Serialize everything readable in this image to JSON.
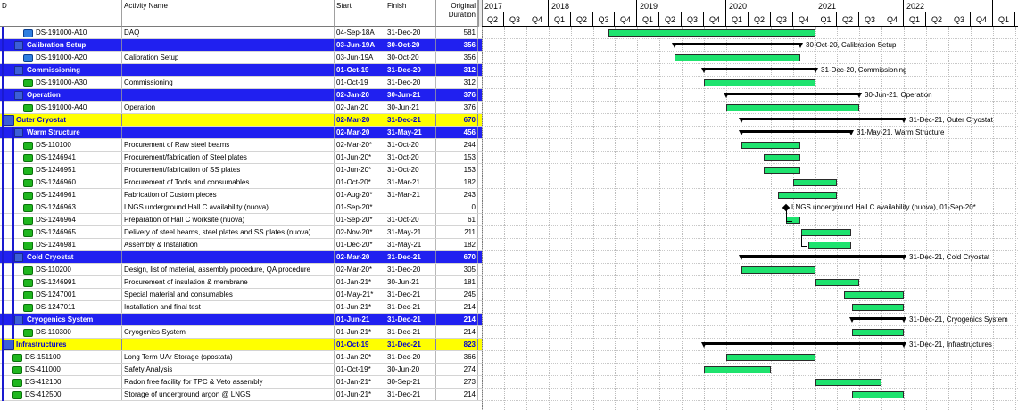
{
  "columns": {
    "id": "D",
    "name": "Activity Name",
    "start": "Start",
    "finish": "Finish",
    "duration_line1": "Original",
    "duration_line2": "Duration"
  },
  "timeline": {
    "years": [
      "2017",
      "2018",
      "2019",
      "2020",
      "2021",
      "2022"
    ],
    "quarters": [
      "Q2",
      "Q3",
      "Q4",
      "Q1",
      "Q2",
      "Q3",
      "Q4",
      "Q1",
      "Q2",
      "Q3",
      "Q4",
      "Q1",
      "Q2",
      "Q3",
      "Q4",
      "Q1",
      "Q2",
      "Q3",
      "Q4",
      "Q1",
      "Q2",
      "Q3",
      "Q4",
      "Q1"
    ]
  },
  "rows": [
    {
      "type": "act",
      "icon": "mile",
      "level": 2,
      "id": "DS-191000-A10",
      "name": "DAQ",
      "start": "04-Sep-18A",
      "finish": "31-Dec-20",
      "dur": "581",
      "bar": {
        "s": 2018.676,
        "f": 2021.0
      },
      "label": ""
    },
    {
      "type": "wbs1",
      "level": 1,
      "id": "Calibration Setup",
      "name": "",
      "start": "03-Jun-19A",
      "finish": "30-Oct-20",
      "dur": "356",
      "sum": {
        "s": 2019.42,
        "f": 2020.83
      },
      "label": "30-Oct-20, Calibration Setup"
    },
    {
      "type": "act",
      "icon": "mile",
      "level": 2,
      "id": "DS-191000-A20",
      "name": "Calibration Setup",
      "start": "03-Jun-19A",
      "finish": "30-Oct-20",
      "dur": "356",
      "bar": {
        "s": 2019.42,
        "f": 2020.83
      },
      "label": ""
    },
    {
      "type": "wbs1",
      "level": 1,
      "id": "Commissioning",
      "name": "",
      "start": "01-Oct-19",
      "finish": "31-Dec-20",
      "dur": "312",
      "sum": {
        "s": 2019.75,
        "f": 2021.0
      },
      "label": "31-Dec-20, Commissioning"
    },
    {
      "type": "act",
      "icon": "task",
      "level": 2,
      "id": "DS-191000-A30",
      "name": "Commissioning",
      "start": "01-Oct-19",
      "finish": "31-Dec-20",
      "dur": "312",
      "bar": {
        "s": 2019.75,
        "f": 2021.0
      },
      "label": ""
    },
    {
      "type": "wbs1",
      "level": 1,
      "id": "Operation",
      "name": "",
      "start": "02-Jan-20",
      "finish": "30-Jun-21",
      "dur": "376",
      "sum": {
        "s": 2020.0,
        "f": 2021.5
      },
      "label": "30-Jun-21, Operation"
    },
    {
      "type": "act",
      "icon": "task",
      "level": 2,
      "id": "DS-191000-A40",
      "name": "Operation",
      "start": "02-Jan-20",
      "finish": "30-Jun-21",
      "dur": "376",
      "bar": {
        "s": 2020.0,
        "f": 2021.5
      },
      "label": ""
    },
    {
      "type": "wbs0",
      "level": 0,
      "id": "Outer Cryostat",
      "name": "",
      "start": "02-Mar-20",
      "finish": "31-Dec-21",
      "dur": "670",
      "sum": {
        "s": 2020.17,
        "f": 2022.0
      },
      "label": "31-Dec-21, Outer Cryostat"
    },
    {
      "type": "wbs1",
      "level": 1,
      "id": "Warm Structure",
      "name": "",
      "start": "02-Mar-20",
      "finish": "31-May-21",
      "dur": "456",
      "sum": {
        "s": 2020.17,
        "f": 2021.41
      },
      "label": "31-May-21, Warm Structure"
    },
    {
      "type": "act",
      "icon": "task",
      "level": 2,
      "id": "DS-110100",
      "name": "Procurement of Raw steel beams",
      "start": "02-Mar-20*",
      "finish": "31-Oct-20",
      "dur": "244",
      "bar": {
        "s": 2020.17,
        "f": 2020.83
      },
      "label": ""
    },
    {
      "type": "act",
      "icon": "task",
      "level": 2,
      "id": "DS-1246941",
      "name": "Procurement/fabrication of Steel plates",
      "start": "01-Jun-20*",
      "finish": "31-Oct-20",
      "dur": "153",
      "bar": {
        "s": 2020.42,
        "f": 2020.83
      },
      "label": ""
    },
    {
      "type": "act",
      "icon": "task",
      "level": 2,
      "id": "DS-1246951",
      "name": "Procurement/fabrication of SS plates",
      "start": "01-Jun-20*",
      "finish": "31-Oct-20",
      "dur": "153",
      "bar": {
        "s": 2020.42,
        "f": 2020.83
      },
      "label": ""
    },
    {
      "type": "act",
      "icon": "task",
      "level": 2,
      "id": "DS-1246960",
      "name": "Procurement of Tools and consumables",
      "start": "01-Oct-20*",
      "finish": "31-Mar-21",
      "dur": "182",
      "bar": {
        "s": 2020.75,
        "f": 2021.25
      },
      "label": ""
    },
    {
      "type": "act",
      "icon": "task",
      "level": 2,
      "id": "DS-1246961",
      "name": "Fabrication of Custom pieces",
      "start": "01-Aug-20*",
      "finish": "31-Mar-21",
      "dur": "243",
      "bar": {
        "s": 2020.58,
        "f": 2021.25
      },
      "label": ""
    },
    {
      "type": "act",
      "icon": "task",
      "level": 2,
      "id": "DS-1246963",
      "name": "LNGS underground Hall C availability (nuova)",
      "start": "01-Sep-20*",
      "finish": "",
      "dur": "0",
      "milestone": 2020.67,
      "label": "LNGS underground Hall C availability (nuova), 01-Sep-20*"
    },
    {
      "type": "act",
      "icon": "task",
      "level": 2,
      "id": "DS-1246964",
      "name": "Preparation of Hall C worksite (nuova)",
      "start": "01-Sep-20*",
      "finish": "31-Oct-20",
      "dur": "61",
      "bar": {
        "s": 2020.67,
        "f": 2020.83
      },
      "label": ""
    },
    {
      "type": "act",
      "icon": "task",
      "level": 2,
      "id": "DS-1246965",
      "name": "Delivery of steel beams, steel plates and SS plates (nuova)",
      "start": "02-Nov-20*",
      "finish": "31-May-21",
      "dur": "211",
      "bar": {
        "s": 2020.84,
        "f": 2021.41
      },
      "label": ""
    },
    {
      "type": "act",
      "icon": "task",
      "level": 2,
      "id": "DS-1246981",
      "name": "Assembly & Installation",
      "start": "01-Dec-20*",
      "finish": "31-May-21",
      "dur": "182",
      "bar": {
        "s": 2020.92,
        "f": 2021.41
      },
      "label": ""
    },
    {
      "type": "wbs1",
      "level": 1,
      "id": "Cold Cryostat",
      "name": "",
      "start": "02-Mar-20",
      "finish": "31-Dec-21",
      "dur": "670",
      "sum": {
        "s": 2020.17,
        "f": 2022.0
      },
      "label": "31-Dec-21, Cold Cryostat"
    },
    {
      "type": "act",
      "icon": "task",
      "level": 2,
      "id": "DS-110200",
      "name": "Design, list of material, assembly procedure, QA procedure",
      "start": "02-Mar-20*",
      "finish": "31-Dec-20",
      "dur": "305",
      "bar": {
        "s": 2020.17,
        "f": 2021.0
      },
      "label": ""
    },
    {
      "type": "act",
      "icon": "task",
      "level": 2,
      "id": "DS-1246991",
      "name": "Procurement of insulation & membrane",
      "start": "01-Jan-21*",
      "finish": "30-Jun-21",
      "dur": "181",
      "bar": {
        "s": 2021.0,
        "f": 2021.5
      },
      "label": ""
    },
    {
      "type": "act",
      "icon": "task",
      "level": 2,
      "id": "DS-1247001",
      "name": "Special material and consumables",
      "start": "01-May-21*",
      "finish": "31-Dec-21",
      "dur": "245",
      "bar": {
        "s": 2021.33,
        "f": 2022.0
      },
      "label": ""
    },
    {
      "type": "act",
      "icon": "task",
      "level": 2,
      "id": "DS-1247011",
      "name": "Installation and final test",
      "start": "01-Jun-21*",
      "finish": "31-Dec-21",
      "dur": "214",
      "bar": {
        "s": 2021.42,
        "f": 2022.0
      },
      "label": ""
    },
    {
      "type": "wbs1",
      "level": 1,
      "id": "Cryogenics System",
      "name": "",
      "start": "01-Jun-21",
      "finish": "31-Dec-21",
      "dur": "214",
      "sum": {
        "s": 2021.42,
        "f": 2022.0
      },
      "label": "31-Dec-21, Cryogenics System"
    },
    {
      "type": "act",
      "icon": "task",
      "level": 2,
      "id": "DS-110300",
      "name": "Cryogenics System",
      "start": "01-Jun-21*",
      "finish": "31-Dec-21",
      "dur": "214",
      "bar": {
        "s": 2021.42,
        "f": 2022.0
      },
      "label": ""
    },
    {
      "type": "wbs0",
      "level": 0,
      "id": "Infrastructures",
      "name": "",
      "start": "01-Oct-19",
      "finish": "31-Dec-21",
      "dur": "823",
      "sum": {
        "s": 2019.75,
        "f": 2022.0
      },
      "label": "31-Dec-21, Infrastructures"
    },
    {
      "type": "act",
      "icon": "task",
      "level": 1,
      "id": "DS-151100",
      "name": "Long Term UAr Storage (spostata)",
      "start": "01-Jan-20*",
      "finish": "31-Dec-20",
      "dur": "366",
      "bar": {
        "s": 2020.0,
        "f": 2021.0
      },
      "label": ""
    },
    {
      "type": "act",
      "icon": "task",
      "level": 1,
      "id": "DS-411000",
      "name": "Safety Analysis",
      "start": "01-Oct-19*",
      "finish": "30-Jun-20",
      "dur": "274",
      "bar": {
        "s": 2019.75,
        "f": 2020.5
      },
      "label": ""
    },
    {
      "type": "act",
      "icon": "task",
      "level": 1,
      "id": "DS-412100",
      "name": "Radon free facility for TPC & Veto assembly",
      "start": "01-Jan-21*",
      "finish": "30-Sep-21",
      "dur": "273",
      "bar": {
        "s": 2021.0,
        "f": 2021.75
      },
      "label": ""
    },
    {
      "type": "act",
      "icon": "task",
      "level": 1,
      "id": "DS-412500",
      "name": "Storage of underground argon @ LNGS",
      "start": "01-Jun-21*",
      "finish": "31-Dec-21",
      "dur": "214",
      "bar": {
        "s": 2021.42,
        "f": 2022.0
      },
      "label": ""
    }
  ]
}
